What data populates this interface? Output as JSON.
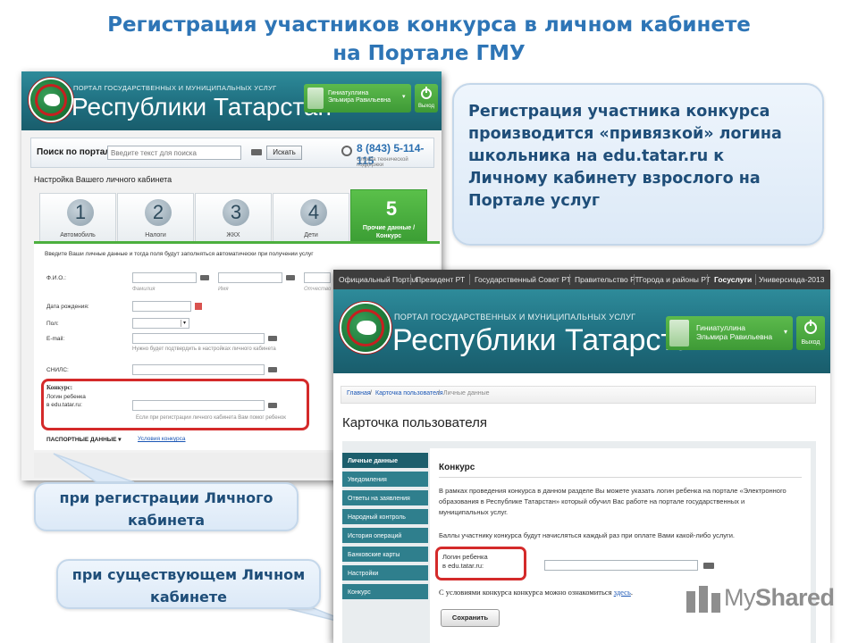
{
  "slide": {
    "title_line1": "Регистрация участников конкурса в личном кабинете",
    "title_line2": "на Портале ГМУ"
  },
  "callouts": {
    "main": "Регистрация участника конкурса производится «привязкой» логина школьника на edu.tatar.ru к Личному кабинету взрослого на Портале услуг",
    "registration": "при регистрации Личного кабинета",
    "existing": "при существующем Личном кабинете"
  },
  "portal": {
    "subtitle": "ПОРТАЛ ГОСУДАРСТВЕННЫХ И МУНИЦИПАЛЬНЫХ УСЛУГ",
    "name": "Республики Татарстан",
    "user_line1": "Гиниатуллина",
    "user_line2": "Эльмира Равильевна",
    "exit_label": "Выход"
  },
  "screen1": {
    "search_label": "Поиск по порталу:",
    "search_placeholder": "Введите текст для поиска",
    "search_button": "Искать",
    "phone": "8 (843) 5-114-115",
    "phone_sub": "Служба технической поддержки",
    "setup_title": "Настройка Вашего личного кабинета",
    "tabs": [
      {
        "num": "1",
        "label": "Автомобиль"
      },
      {
        "num": "2",
        "label": "Налоги"
      },
      {
        "num": "3",
        "label": "ЖКХ"
      },
      {
        "num": "4",
        "label": "Дети"
      },
      {
        "num": "5",
        "label": "Прочие данные / Конкурс"
      }
    ],
    "form_note": "Введите Ваши личные данные и тогда поля будут заполняться автоматически при получении услуг",
    "fio_label": "Ф.И.О.:",
    "fio_hints": [
      "Фамилия",
      "Имя",
      "Отчество"
    ],
    "birth_label": "Дата рождения:",
    "gender_label": "Пол:",
    "email_label": "E-mail:",
    "email_hint": "Нужно будет подтвердить в настройках личного кабинета",
    "snils_label": "СНИЛС:",
    "contest_title": "Конкурс:",
    "child_login_line1": "Логин ребенка",
    "child_login_line2": "в edu.tatar.ru:",
    "contest_hint": "Если при регистрации личного кабинета Вам помог ребенок",
    "passport_label": "ПАСПОРТНЫЕ ДАННЫЕ",
    "contest_link": "Условия конкурса"
  },
  "screen2": {
    "nav": [
      "Официальный Портал",
      "Президент РТ",
      "Государственный Совет РТ",
      "Правительство РТ",
      "Города и районы РТ",
      "Госуслуги",
      "Универсиада-2013"
    ],
    "nav_active": 5,
    "breadcrumbs": [
      "Главная",
      "Карточка пользователя",
      "Личные данные"
    ],
    "page_title": "Карточка пользователя",
    "sidebar": [
      "Личные данные",
      "Уведомления",
      "Ответы на заявления",
      "Народный контроль",
      "История операций",
      "Банковские карты",
      "Настройки",
      "Конкурс"
    ],
    "sidebar_active": 0,
    "section_title": "Конкурс",
    "para1_line1": "В рамках проведения конкурса в данном разделе Вы можете указать логин ребенка на портале «Электронного",
    "para1_line2": "образования в Республике Татарстан» который обучил Вас работе на портале государственных и",
    "para1_line3": "муниципальных услуг.",
    "para2": "Баллы участнику конкурса будут начисляться каждый раз при оплате Вами какой-либо услуги.",
    "child_login_line1": "Логин ребенка",
    "child_login_line2": "в edu.tatar.ru:",
    "rules_text": "С условиями конкурса конкурса можно ознакомиться",
    "rules_link": "здесь",
    "save_button": "Сохранить"
  },
  "watermark": {
    "text_light": "My",
    "text_bold": "Shared"
  },
  "colors": {
    "title": "#2e75b6",
    "callout_text": "#1f4e79",
    "portal_teal": "#1f6f80",
    "green": "#4caf3e",
    "highlight_red": "#d42a2a"
  }
}
